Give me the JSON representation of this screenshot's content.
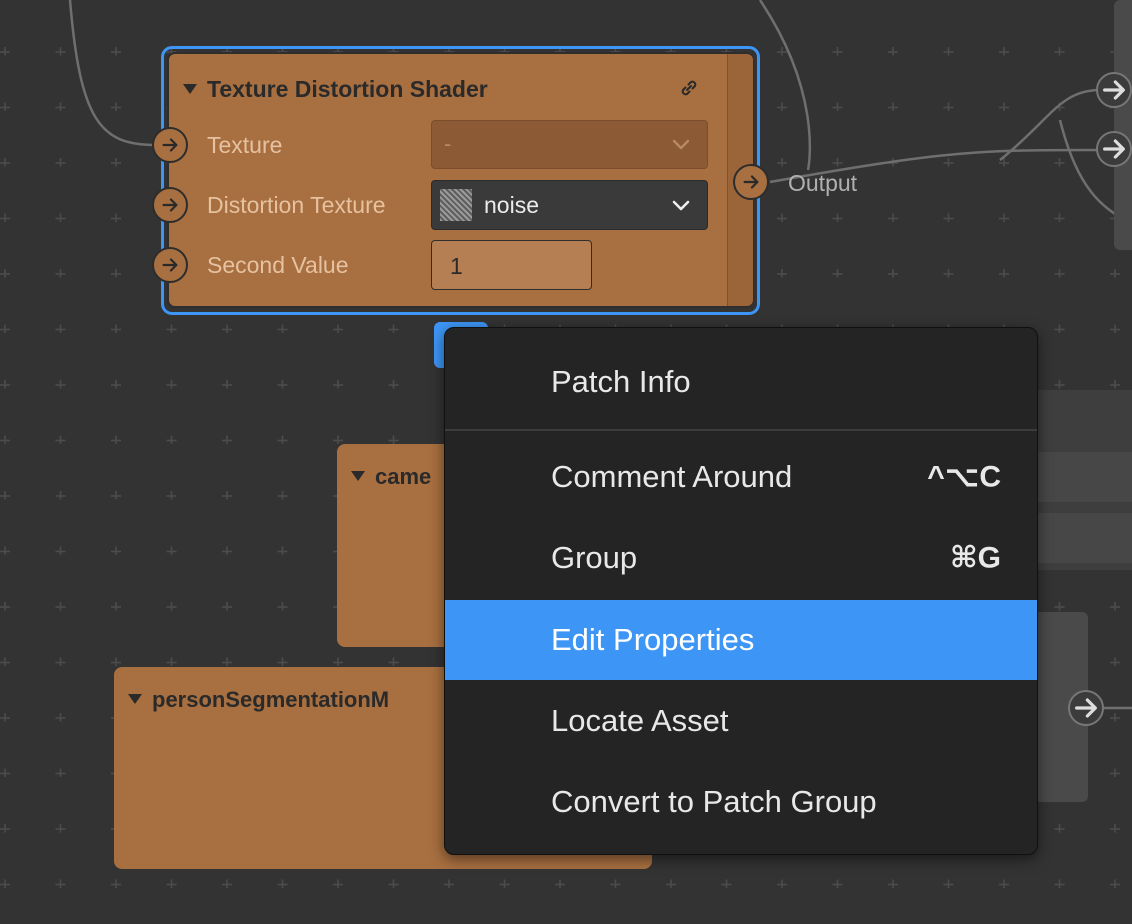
{
  "node_main": {
    "title": "Texture Distortion Shader",
    "inputs": [
      {
        "label": "Texture",
        "value": "-"
      },
      {
        "label": "Distortion Texture",
        "value": "noise"
      },
      {
        "label": "Second Value",
        "value": "1"
      }
    ],
    "output_label": "Output"
  },
  "node_camera": {
    "title": "came"
  },
  "node_person": {
    "title": "personSegmentationM"
  },
  "context_menu": {
    "items": [
      {
        "label": "Patch Info",
        "shortcut": ""
      },
      {
        "label": "Comment Around",
        "shortcut": "^⌥C"
      },
      {
        "label": "Group",
        "shortcut": "⌘G"
      },
      {
        "label": "Edit Properties",
        "shortcut": ""
      },
      {
        "label": "Locate Asset",
        "shortcut": ""
      },
      {
        "label": "Convert to Patch Group",
        "shortcut": ""
      }
    ],
    "highlighted": "Edit Properties"
  },
  "colors": {
    "canvas": "#333333",
    "node": "#a86f40",
    "selection": "#3d95f5",
    "menu_bg": "#242424"
  }
}
